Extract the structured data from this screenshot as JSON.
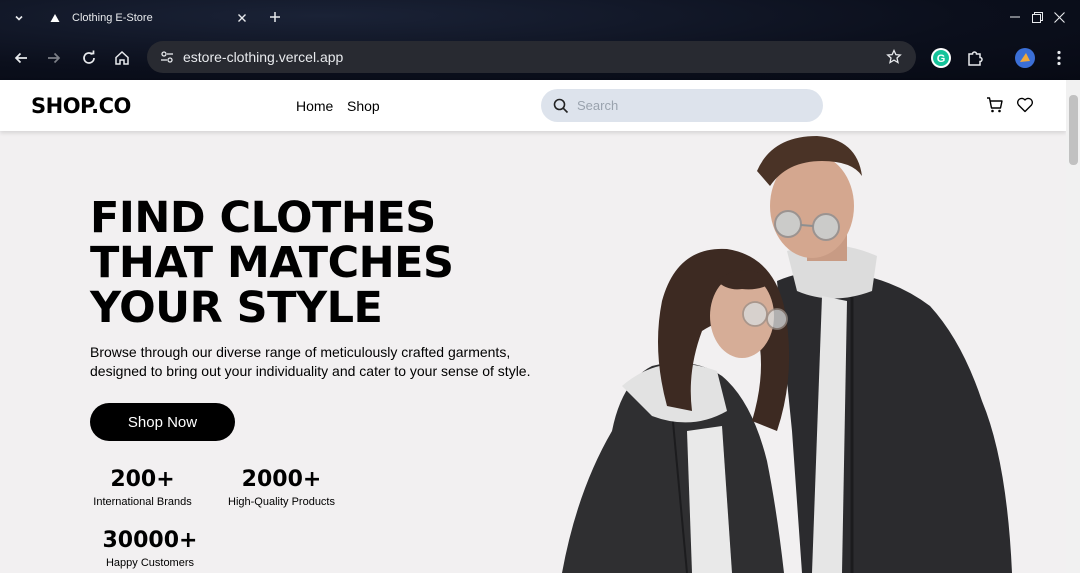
{
  "browser": {
    "tab_title": "Clothing E-Store",
    "url": "estore-clothing.vercel.app"
  },
  "site": {
    "logo": "SHOP.CO",
    "nav": [
      {
        "label": "Home"
      },
      {
        "label": "Shop"
      }
    ],
    "search_placeholder": "Search"
  },
  "hero": {
    "title_lines": [
      "FIND CLOTHES",
      "THAT MATCHES",
      "YOUR STYLE"
    ],
    "description": "Browse through our diverse range of meticulously crafted garments, designed to bring out your individuality and cater to your sense of style.",
    "cta_label": "Shop Now",
    "stats": [
      {
        "number": "200+",
        "label": "International Brands"
      },
      {
        "number": "2000+",
        "label": "High-Quality Products"
      },
      {
        "number": "30000+",
        "label": "Happy Customers"
      }
    ]
  },
  "colors": {
    "hero_bg": "#f2f0f1",
    "search_bg": "#dde3ec",
    "cta_bg": "#000000"
  }
}
